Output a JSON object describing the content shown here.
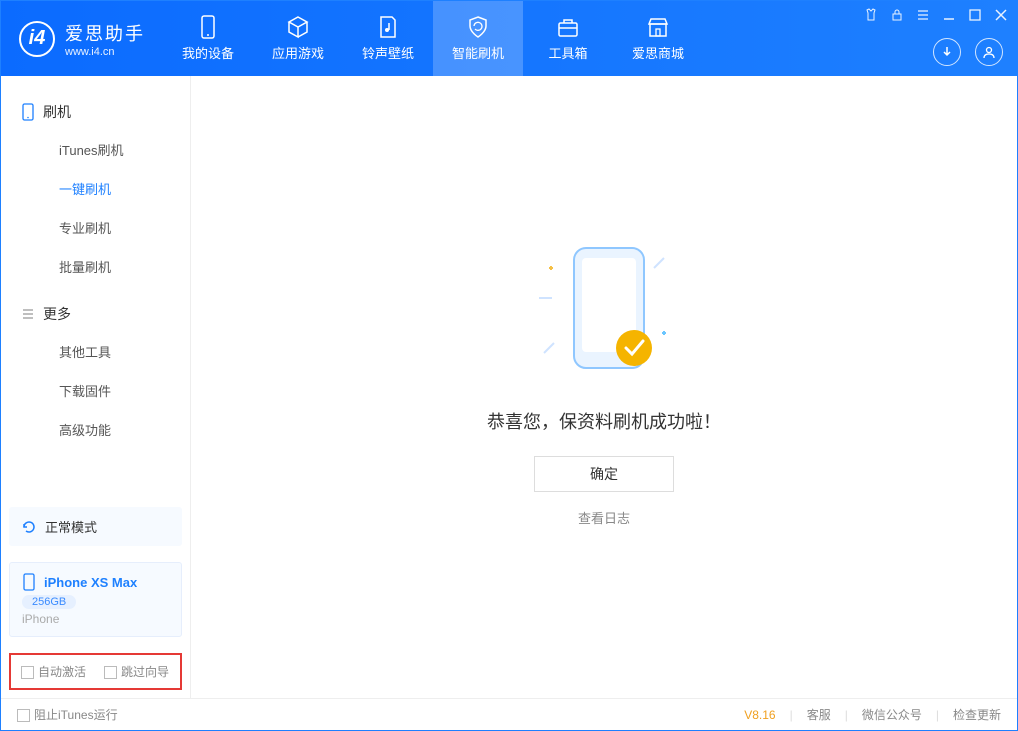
{
  "app": {
    "name": "爱思助手",
    "site": "www.i4.cn"
  },
  "header_tabs": [
    {
      "label": "我的设备",
      "icon": "device"
    },
    {
      "label": "应用游戏",
      "icon": "cube"
    },
    {
      "label": "铃声壁纸",
      "icon": "music"
    },
    {
      "label": "智能刷机",
      "icon": "shield",
      "active": true
    },
    {
      "label": "工具箱",
      "icon": "toolbox"
    },
    {
      "label": "爱思商城",
      "icon": "shop"
    }
  ],
  "sidebar": {
    "group1": {
      "title": "刷机",
      "items": [
        "iTunes刷机",
        "一键刷机",
        "专业刷机",
        "批量刷机"
      ],
      "active_index": 1
    },
    "group2": {
      "title": "更多",
      "items": [
        "其他工具",
        "下载固件",
        "高级功能"
      ]
    }
  },
  "mode": {
    "label": "正常模式"
  },
  "device": {
    "name": "iPhone XS Max",
    "capacity": "256GB",
    "type": "iPhone"
  },
  "options": {
    "auto_activate": "自动激活",
    "skip_guide": "跳过向导"
  },
  "main": {
    "success_text": "恭喜您，保资料刷机成功啦！",
    "ok_button": "确定",
    "view_log": "查看日志"
  },
  "footer": {
    "block_itunes": "阻止iTunes运行",
    "version": "V8.16",
    "support": "客服",
    "wechat": "微信公众号",
    "check_update": "检查更新"
  }
}
